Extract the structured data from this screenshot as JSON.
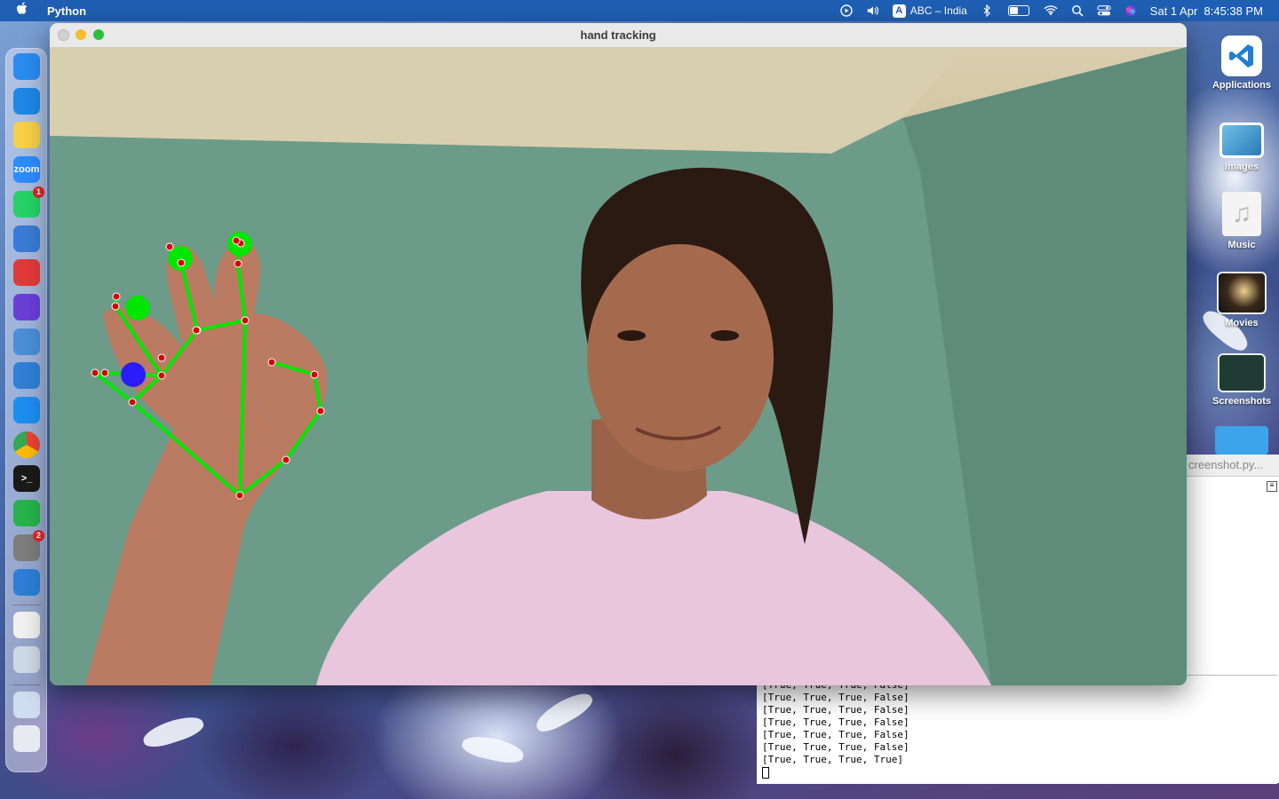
{
  "menubar": {
    "app_name": "Python",
    "input_source_badge": "A",
    "input_source": "ABC – India",
    "datetime": "Sat 1 Apr  8:45:38 PM",
    "icons": [
      "apple-icon",
      "screen-record-icon",
      "volume-icon",
      "bluetooth-icon",
      "battery-icon",
      "wifi-icon",
      "spotlight-icon",
      "control-center-icon",
      "siri-icon"
    ]
  },
  "window": {
    "title": "hand tracking"
  },
  "dock": {
    "items": [
      {
        "name": "finder",
        "label": "",
        "color": "#2a8cf0",
        "badge": ""
      },
      {
        "name": "safari",
        "label": "",
        "color": "#1e88e5",
        "badge": ""
      },
      {
        "name": "notes",
        "label": "",
        "color": "#f7d046",
        "badge": ""
      },
      {
        "name": "zoom",
        "label": "zoom",
        "color": "#2d8cff",
        "badge": ""
      },
      {
        "name": "whatsapp",
        "label": "",
        "color": "#25d366",
        "badge": "1"
      },
      {
        "name": "quicktime",
        "label": "",
        "color": "#3a7bd5",
        "badge": ""
      },
      {
        "name": "photo-booth",
        "label": "",
        "color": "#e23a3a",
        "badge": ""
      },
      {
        "name": "imovie",
        "label": "",
        "color": "#6a3fd8",
        "badge": ""
      },
      {
        "name": "preview",
        "label": "",
        "color": "#4b8fd6",
        "badge": ""
      },
      {
        "name": "vscode",
        "label": "",
        "color": "#2f80d6",
        "badge": ""
      },
      {
        "name": "app-store",
        "label": "",
        "color": "#1c8ef2",
        "badge": ""
      },
      {
        "name": "chrome",
        "label": "",
        "color": "#ffffff",
        "badge": ""
      },
      {
        "name": "terminal",
        "label": ">_",
        "color": "#1a1a1a",
        "badge": ""
      },
      {
        "name": "messages",
        "label": "",
        "color": "#27b34a",
        "badge": ""
      },
      {
        "name": "system-preferences",
        "label": "",
        "color": "#7d7d7d",
        "badge": "2"
      },
      {
        "name": "game",
        "label": "",
        "color": "#2c7fd6",
        "badge": ""
      },
      {
        "name": "python-launcher",
        "label": "",
        "color": "#f0f0f0",
        "badge": ""
      },
      {
        "name": "rocket-app",
        "label": "",
        "color": "#cfd8e6",
        "badge": ""
      },
      {
        "name": "downloads-stack",
        "label": "",
        "color": "#d0dcef",
        "badge": ""
      },
      {
        "name": "trash",
        "label": "",
        "color": "#e6eaf0",
        "badge": ""
      }
    ]
  },
  "desktop_icons": [
    {
      "label": "Applications",
      "icon": "vscode-icon"
    },
    {
      "label": "Images",
      "icon": "images-icon"
    },
    {
      "label": "Music",
      "icon": "music-icon"
    },
    {
      "label": "Movies",
      "icon": "movies-icon"
    },
    {
      "label": "Screenshots",
      "icon": "screenshots-icon"
    }
  ],
  "editor_tab": {
    "label": "creenshot.py..."
  },
  "terminal": {
    "lines": [
      "[True, True, True, False]",
      "[True, True, True, False]",
      "[True, True, True, False]",
      "[True, True, True, False]",
      "[True, True, True, False]",
      "[True, True, True, False]",
      "[True, True, True, True]"
    ],
    "line_0": "[True, True, True, False]",
    "line_1": "[True, True, True, False]",
    "line_2": "[True, True, True, False]",
    "line_3": "[True, True, True, False]",
    "line_4": "[True, True, True, False]",
    "line_5": "[True, True, True, False]",
    "line_6": "[True, True, True, True]"
  },
  "colors": {
    "skeleton": "#00e600",
    "landmark": "#d40000",
    "fingertip": "#00e600",
    "thumb_tip": "#2a1cff",
    "menubar": "#1f5fb3"
  }
}
